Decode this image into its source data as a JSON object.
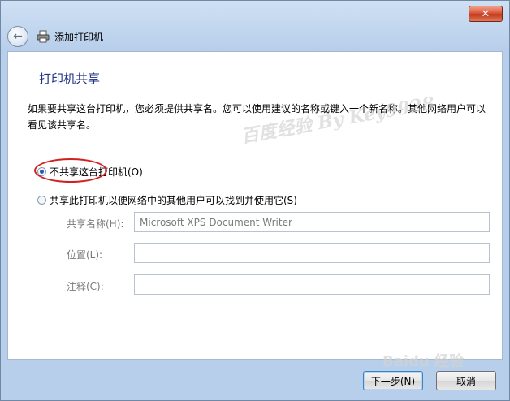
{
  "window": {
    "close_label": "✕"
  },
  "nav": {
    "back_glyph": "←",
    "title": "添加打印机"
  },
  "page": {
    "title": "打印机共享",
    "description": "如果要共享这台打印机，您必须提供共享名。您可以使用建议的名称或键入一个新名称。其他网络用户可以看见该共享名。"
  },
  "options": {
    "no_share": {
      "label": "不共享这台打印机(O)",
      "selected": true
    },
    "share": {
      "label": "共享此打印机以便网络中的其他用户可以找到并使用它(S)",
      "selected": false
    }
  },
  "fields": {
    "share_name": {
      "label": "共享名称(H):",
      "value": "Microsoft XPS Document Writer"
    },
    "location": {
      "label": "位置(L):",
      "value": ""
    },
    "comment": {
      "label": "注释(C):",
      "value": ""
    }
  },
  "buttons": {
    "next": "下一步(N)",
    "cancel": "取消"
  },
  "watermarks": {
    "main": "百度经验 By Key9928",
    "corner": "Baidu 经验"
  },
  "colors": {
    "title_blue": "#1e3287",
    "annotation_red": "#d02020"
  },
  "icons": {
    "back": "back-arrow-icon",
    "printer": "printer-icon"
  }
}
